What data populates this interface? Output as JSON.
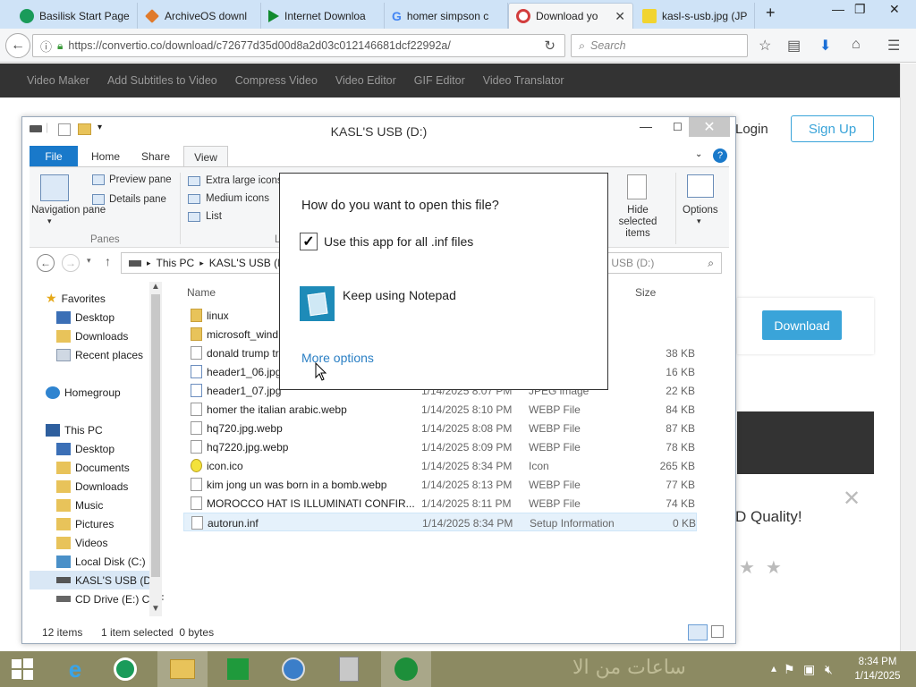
{
  "browser": {
    "tabs": [
      {
        "label": "Basilisk Start Page",
        "icon_color": "#1a9b5a"
      },
      {
        "label": "ArchiveOS downl",
        "icon_color": "#e07a2b"
      },
      {
        "label": "Internet Downloa",
        "icon_color": "#118a2e"
      },
      {
        "label": "homer simpson c",
        "icon_color": "#4285f4"
      },
      {
        "label": "Download yo",
        "icon_color": "#d23d3d"
      },
      {
        "label": "kasl-s-usb.jpg (JP",
        "icon_color": "#f1d430"
      }
    ],
    "new_tab": "+",
    "url": "https://convertio.co/download/c72677d35d00d8a2d03c012146681dcf22992a/",
    "search_placeholder": "Search"
  },
  "site_nav": [
    "Video Maker",
    "Add Subtitles to Video",
    "Compress Video",
    "Video Editor",
    "GIF Editor",
    "Video Translator"
  ],
  "page": {
    "login": "Login",
    "signup": "Sign Up",
    "download": "Download",
    "quality": "D Quality!"
  },
  "explorer": {
    "title": "KASL'S USB (D:)",
    "ribbon_tabs": [
      "File",
      "Home",
      "Share",
      "View"
    ],
    "ribbon": {
      "navigation_pane": "Navigation pane",
      "preview_pane": "Preview pane",
      "details_pane": "Details pane",
      "panes_group": "Panes",
      "extra_large_icons": "Extra large icons",
      "medium_icons": "Medium icons",
      "list": "List",
      "group_l": "L",
      "hide_selected": "Hide selected items",
      "options": "Options"
    },
    "breadcrumb": [
      "This PC",
      "KASL'S USB (I"
    ],
    "search_placeholder": "S USB (D:)",
    "nav": [
      {
        "label": "Favorites",
        "icon": "star-icon"
      },
      {
        "label": "Desktop",
        "icon": "desktop-icon"
      },
      {
        "label": "Downloads",
        "icon": "downloads-icon"
      },
      {
        "label": "Recent places",
        "icon": "recent-icon"
      },
      {
        "label": "Homegroup",
        "icon": "homegroup-icon"
      },
      {
        "label": "This PC",
        "icon": "pc-icon"
      },
      {
        "label": "Desktop",
        "icon": "desktop-icon"
      },
      {
        "label": "Documents",
        "icon": "documents-icon"
      },
      {
        "label": "Downloads",
        "icon": "downloads-icon"
      },
      {
        "label": "Music",
        "icon": "music-icon"
      },
      {
        "label": "Pictures",
        "icon": "pictures-icon"
      },
      {
        "label": "Videos",
        "icon": "videos-icon"
      },
      {
        "label": "Local Disk (C:)",
        "icon": "drive-icon"
      },
      {
        "label": "KASL'S USB (D:)",
        "icon": "usb-icon"
      },
      {
        "label": "CD Drive (E:) CDF",
        "icon": "cd-icon"
      }
    ],
    "columns": {
      "name": "Name",
      "size": "Size"
    },
    "files": [
      {
        "name": "linux",
        "date": "",
        "type": "",
        "size": "",
        "kind": "folder"
      },
      {
        "name": "microsoft_wind",
        "date": "",
        "type": "",
        "size": "",
        "kind": "folder"
      },
      {
        "name": "donald trump tr",
        "date": "",
        "type": "",
        "size": "38 KB",
        "kind": "doc"
      },
      {
        "name": "header1_06.jpg",
        "date": "",
        "type": "",
        "size": "16 KB",
        "kind": "img"
      },
      {
        "name": "header1_07.jpg",
        "date": "1/14/2025 8:07 PM",
        "type": "JPEG image",
        "size": "22 KB",
        "kind": "img"
      },
      {
        "name": "homer the italian arabic.webp",
        "date": "1/14/2025 8:10 PM",
        "type": "WEBP File",
        "size": "84 KB",
        "kind": "doc"
      },
      {
        "name": "hq720.jpg.webp",
        "date": "1/14/2025 8:08 PM",
        "type": "WEBP File",
        "size": "87 KB",
        "kind": "doc"
      },
      {
        "name": "hq7220.jpg.webp",
        "date": "1/14/2025 8:09 PM",
        "type": "WEBP File",
        "size": "78 KB",
        "kind": "doc"
      },
      {
        "name": "icon.ico",
        "date": "1/14/2025 8:34 PM",
        "type": "Icon",
        "size": "265 KB",
        "kind": "ico"
      },
      {
        "name": "kim jong un was born in a bomb.webp",
        "date": "1/14/2025 8:13 PM",
        "type": "WEBP File",
        "size": "77 KB",
        "kind": "doc"
      },
      {
        "name": "MOROCCO HAT IS ILLUMINATI CONFIR...",
        "date": "1/14/2025 8:11 PM",
        "type": "WEBP File",
        "size": "74 KB",
        "kind": "doc"
      },
      {
        "name": "autorun.inf",
        "date": "1/14/2025 8:34 PM",
        "type": "Setup Information",
        "size": "0 KB",
        "kind": "doc",
        "selected": true
      }
    ],
    "status": {
      "items": "12 items",
      "selected": "1 item selected  0 bytes"
    }
  },
  "dialog": {
    "title": "How do you want to open this file?",
    "checkbox_label": "Use this app for all .inf files",
    "checkbox_checked": true,
    "app_name": "Keep using Notepad",
    "more_options": "More options"
  },
  "taskbar": {
    "time": "8:34 PM",
    "date": "1/14/2025",
    "wallpaper_text": "ساعات من الا"
  }
}
